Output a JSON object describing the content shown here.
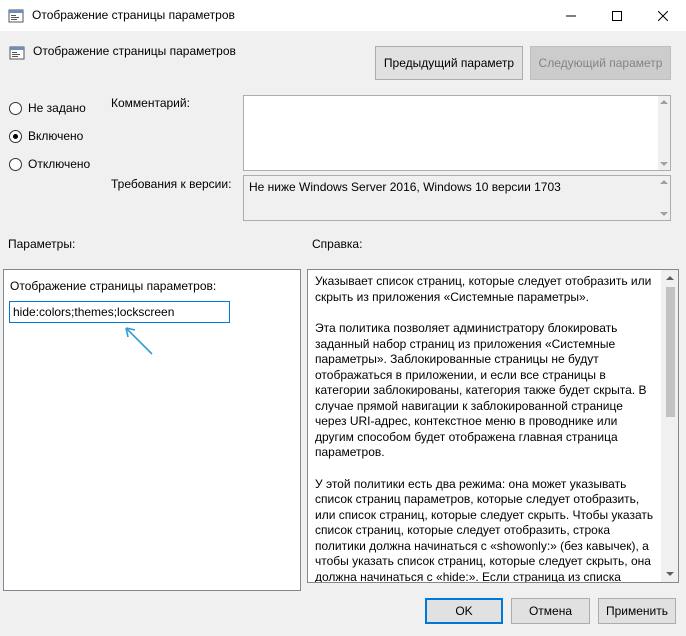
{
  "window": {
    "title": "Отображение страницы параметров",
    "controls": [
      "minimize-icon",
      "maximize-icon",
      "close-icon"
    ]
  },
  "header": {
    "title": "Отображение страницы параметров",
    "prev_button": "Предыдущий параметр",
    "next_button": "Следующий параметр"
  },
  "state_options": [
    {
      "label": "Не задано",
      "checked": false
    },
    {
      "label": "Включено",
      "checked": true
    },
    {
      "label": "Отключено",
      "checked": false
    }
  ],
  "comment": {
    "label": "Комментарий:",
    "value": ""
  },
  "requirements": {
    "label": "Требования к версии:",
    "value": "Не ниже Windows Server 2016, Windows 10 версии 1703"
  },
  "params": {
    "section_label": "Параметры:",
    "field_label": "Отображение страницы параметров:",
    "field_value": "hide:colors;themes;lockscreen"
  },
  "help": {
    "section_label": "Справка:",
    "paragraphs": [
      "Указывает список страниц, которые следует отобразить или скрыть из приложения «Системные параметры».",
      "Эта политика позволяет администратору блокировать заданный набор страниц из приложения «Системные параметры». Заблокированные страницы не будут отображаться в приложении, и если все страницы в категории заблокированы, категория также будет скрыта. В случае прямой навигации к заблокированной странице через URI-адрес, контекстное меню в проводнике или другим способом будет отображена главная страница параметров.",
      "У этой политики есть два режима: она может указывать список страниц параметров, которые следует отобразить, или список страниц, которые следует скрыть. Чтобы указать список страниц, которые следует отобразить, строка политики должна начинаться с «showonly:» (без кавычек), а чтобы указать список страниц, которые следует скрыть, она должна начинаться с «hide:». Если страница из списка showonly обычно была бы скрыта по другим причинам (например, из-за отсутствия устройства), эта политика не"
    ]
  },
  "footer": {
    "ok": "OK",
    "cancel": "Отмена",
    "apply": "Применить"
  },
  "colors": {
    "accent": "#0078d7",
    "annotation_arrow": "#2a9fd6"
  }
}
